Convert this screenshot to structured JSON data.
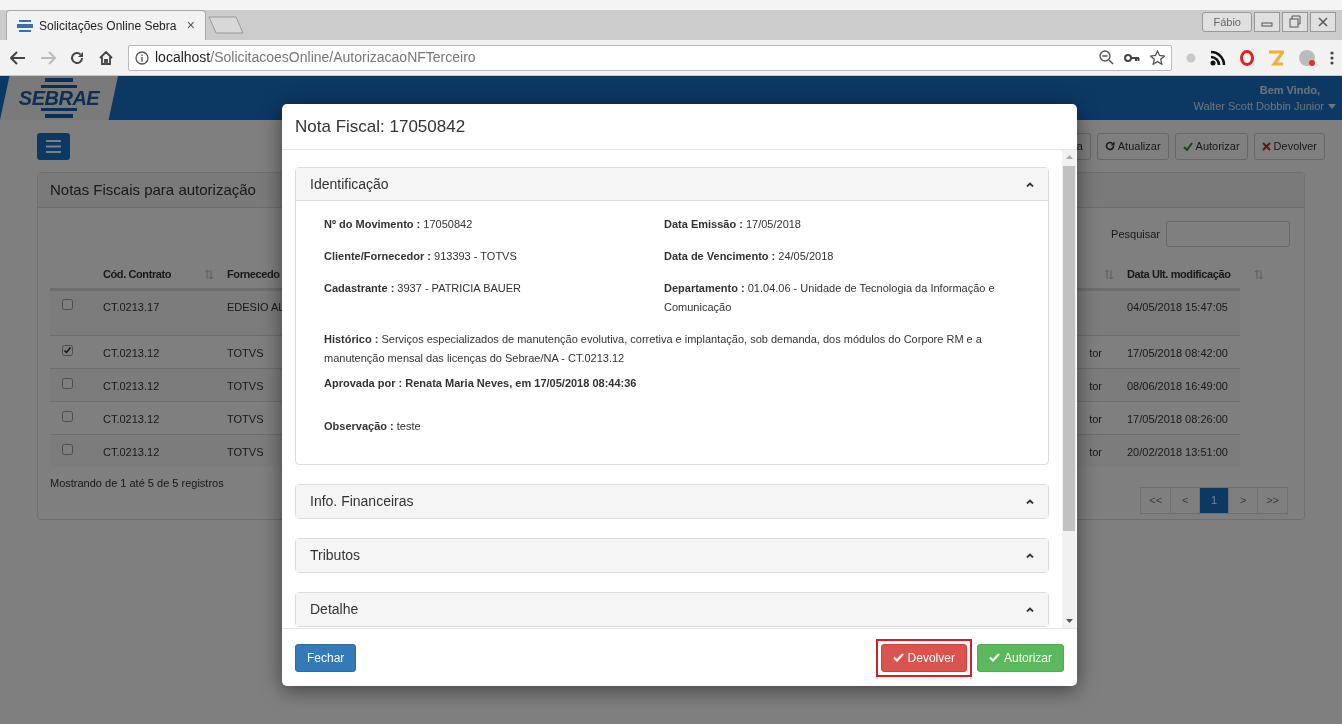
{
  "browser": {
    "tab_title": "Solicitações Online Sebra",
    "tab_close": "×",
    "url_host": "localhost",
    "url_path": "/SolicitacoesOnline/AutorizacaoNFTerceiro",
    "profile": "Fábio"
  },
  "app": {
    "logo": "SEBRAE",
    "greeting": "Bem Vindo,",
    "user": "Walter Scott Dobbin Junior"
  },
  "toolbar": [
    {
      "label": "a"
    },
    {
      "label": "Atualizar"
    },
    {
      "label": "Autorizar"
    },
    {
      "label": "Devolver"
    }
  ],
  "panel": {
    "title": "Notas Fiscais para autorização",
    "search_label": "Pesquisar",
    "columns": {
      "contract": "Cód. Contrato",
      "supplier": "Fornecedo",
      "modified": "Data Ult. modificação"
    },
    "rows": [
      {
        "checked": false,
        "contract": "CT.0213.17",
        "supplier": "EDESIO AL",
        "modified": "04/05/2018 15:47:05"
      },
      {
        "checked": true,
        "contract": "CT.0213.12",
        "supplier": "TOTVS",
        "column_4": "tor",
        "modified": "17/05/2018 08:42:00"
      },
      {
        "checked": false,
        "contract": "CT.0213.12",
        "supplier": "TOTVS",
        "column_4": "tor",
        "modified": "08/06/2018 16:49:00"
      },
      {
        "checked": false,
        "contract": "CT.0213.12",
        "supplier": "TOTVS",
        "column_4": "tor",
        "modified": "17/05/2018 08:26:00"
      },
      {
        "checked": false,
        "contract": "CT.0213.12",
        "supplier": "TOTVS",
        "column_4": "tor",
        "modified": "20/02/2018 13:51:00"
      }
    ],
    "info": "Mostrando de 1 até 5 de 5 registros",
    "pagination": [
      {
        "label": "<<",
        "selected": false
      },
      {
        "label": "<",
        "selected": false
      },
      {
        "label": "1",
        "selected": true
      },
      {
        "label": ">",
        "selected": false
      },
      {
        "label": ">>",
        "selected": false
      }
    ]
  },
  "modal": {
    "title": "Nota Fiscal: 17050842",
    "sections": [
      {
        "title": "Identificação",
        "expanded": true,
        "fields": [
          {
            "kind": "half",
            "label": "Nº do Movimento :",
            "value": "17050842"
          },
          {
            "kind": "half",
            "label": "Data Emissão :",
            "value": "17/05/2018"
          },
          {
            "kind": "half",
            "label": "Cliente/Fornecedor :",
            "value": "913393 - TOTVS"
          },
          {
            "kind": "half",
            "label": "Data de Vencimento :",
            "value": "24/05/2018"
          },
          {
            "kind": "half",
            "label": "Cadastrante :",
            "value": "3937 - PATRICIA BAUER"
          },
          {
            "kind": "half",
            "label": "Departamento :",
            "value": "01.04.06 - Unidade de Tecnologia da Informação e Comunicação"
          },
          {
            "kind": "wide",
            "label": "Histórico :",
            "value": "Serviços especializados de manutenção evolutiva, corretiva e implantação, sob demanda, dos módulos do Corpore RM e a manutenção mensal das licenças do Sebrae/NA - CT.0213.12"
          },
          {
            "kind": "approval",
            "label": "Aprovada por :",
            "value": "Renata Maria Neves, em 17/05/2018 08:44:36"
          },
          {
            "kind": "note",
            "label": "Observação :",
            "value": "teste"
          }
        ]
      },
      {
        "title": "Info. Financeiras",
        "expanded": false
      },
      {
        "title": "Tributos",
        "expanded": false
      },
      {
        "title": "Detalhe",
        "expanded": false
      }
    ],
    "buttons": [
      {
        "label": "Fechar",
        "highlighted": false
      },
      {
        "label": "Devolver",
        "highlighted": true
      },
      {
        "label": "Autorizar",
        "highlighted": false
      }
    ]
  }
}
